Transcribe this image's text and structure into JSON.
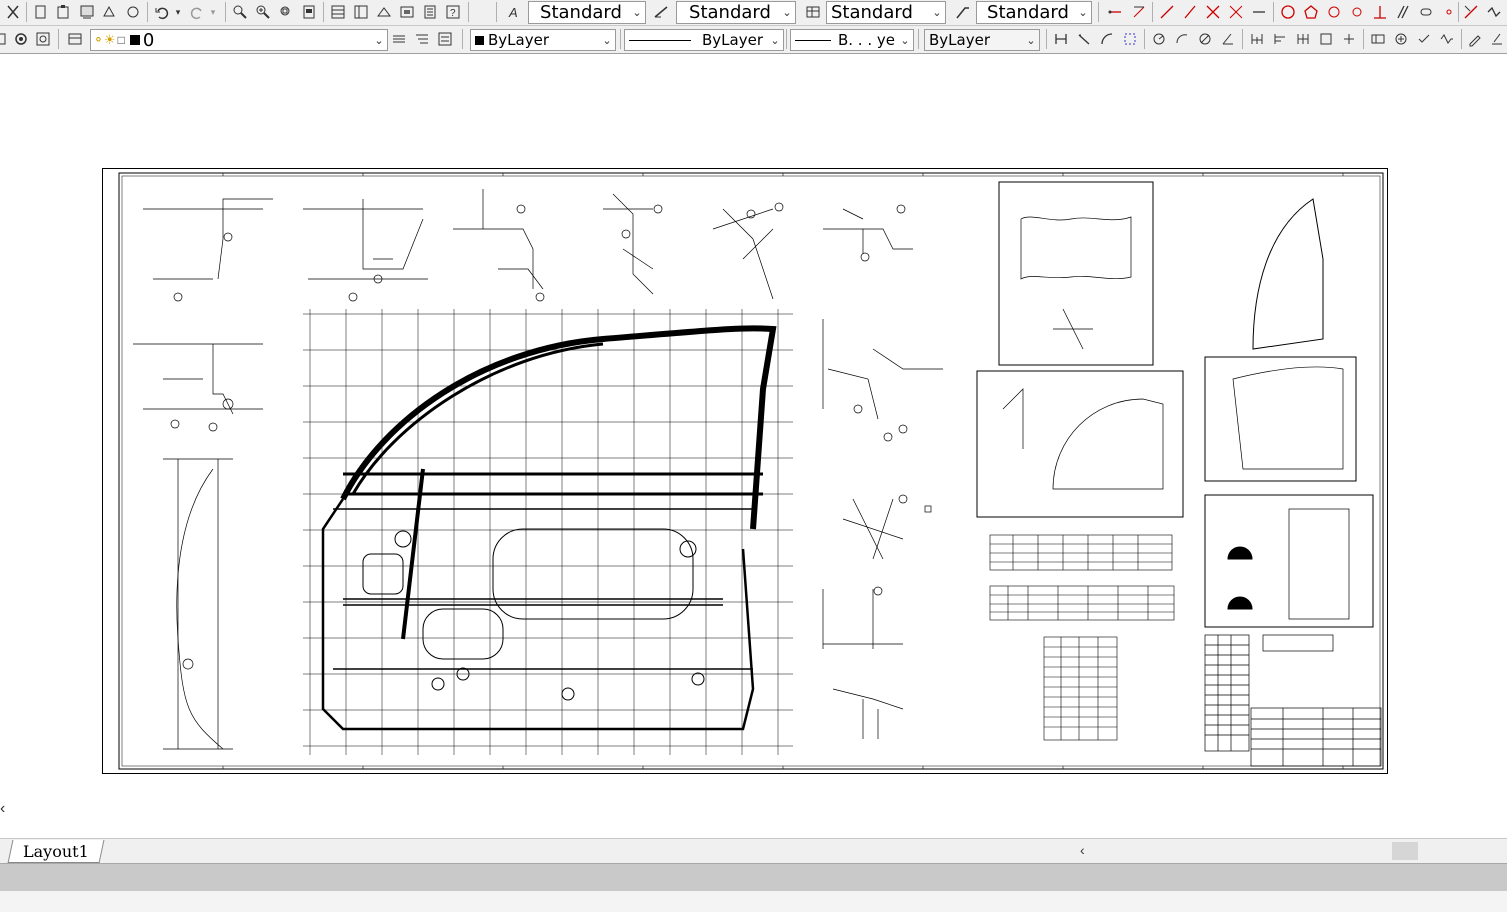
{
  "toolbar1": {
    "text_style": "Standard",
    "dim_style": "Standard",
    "table_style": "Standard",
    "mleader_style": "Standard"
  },
  "toolbar2": {
    "layer": "0",
    "color": "ByLayer",
    "linetype": "ByLayer",
    "lineweight": "B. . . ye",
    "plot_style": "ByLayer"
  },
  "layout_tab": "Layout1",
  "colors": {
    "toolbar_bg": "#f0f0f0",
    "canvas_bg": "#ffffff",
    "status_bg": "#c9c9c9",
    "ink": "#000000"
  }
}
